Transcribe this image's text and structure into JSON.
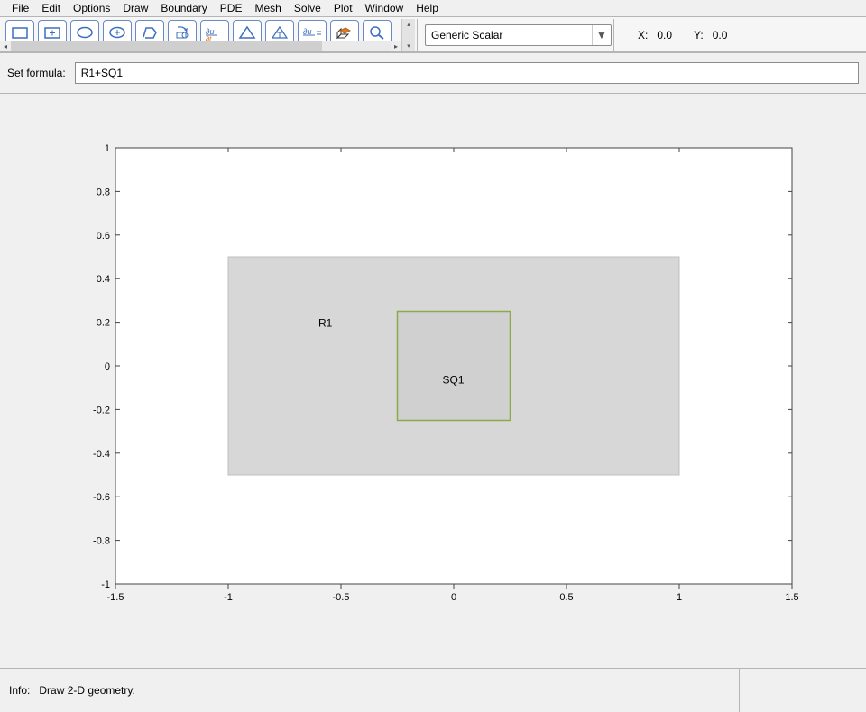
{
  "menu": {
    "items": [
      "File",
      "Edit",
      "Options",
      "Draw",
      "Boundary",
      "PDE",
      "Mesh",
      "Solve",
      "Plot",
      "Window",
      "Help"
    ]
  },
  "toolbar": {
    "icons": [
      "rectangle-corner-icon",
      "rectangle-center-icon",
      "ellipse-edge-icon",
      "ellipse-center-icon",
      "polygon-icon",
      "geom-refresh-icon",
      "pde-spec-icon",
      "mesh-triangle-icon",
      "refine-triangle-icon",
      "solve-equals-icon",
      "plot3d-icon",
      "zoom-icon"
    ],
    "pde_type_selected": "Generic Scalar"
  },
  "coords": {
    "x_label": "X:",
    "y_label": "Y:",
    "x_value": "0.0",
    "y_value": "0.0"
  },
  "formula": {
    "label": "Set formula:",
    "value": "R1+SQ1"
  },
  "chart_data": {
    "type": "geometry",
    "xlim": [
      -1.5,
      1.5
    ],
    "ylim": [
      -1,
      1
    ],
    "xticks": [
      -1.5,
      -1,
      -0.5,
      0,
      0.5,
      1,
      1.5
    ],
    "yticks": [
      -1,
      -0.8,
      -0.6,
      -0.4,
      -0.2,
      0,
      0.2,
      0.4,
      0.6,
      0.8,
      1
    ],
    "shapes": [
      {
        "name": "R1",
        "type": "rectangle",
        "x0": -1.0,
        "x1": 1.0,
        "y0": -0.5,
        "y1": 0.5,
        "label_pos": [
          -0.6,
          0.18
        ]
      },
      {
        "name": "SQ1",
        "type": "rectangle",
        "x0": -0.25,
        "x1": 0.25,
        "y0": -0.25,
        "y1": 0.25,
        "label_pos": [
          -0.05,
          -0.08
        ]
      }
    ]
  },
  "status": {
    "label": "Info:",
    "text": "Draw 2-D geometry."
  }
}
